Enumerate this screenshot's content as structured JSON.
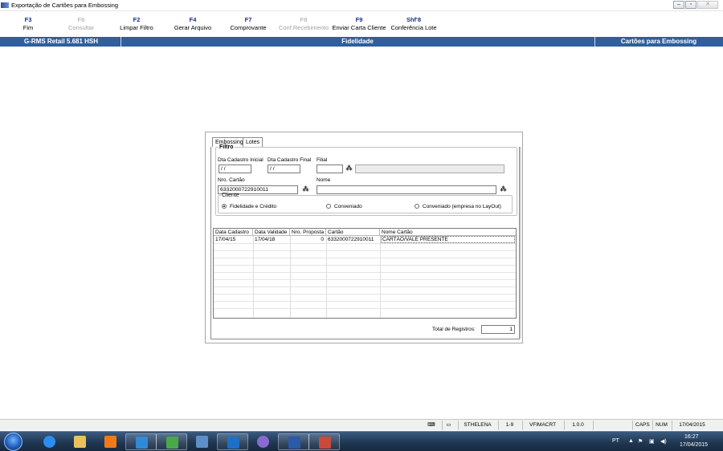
{
  "window": {
    "title": "Exportação de Cartões para Embossing",
    "controls": [
      "minimize-icon",
      "restore-icon",
      "close-icon"
    ]
  },
  "toolbar": [
    {
      "key": "F3",
      "label": "Fim",
      "enabled": true
    },
    {
      "key": "F6",
      "label": "Consultar",
      "enabled": false
    },
    {
      "key": "F2",
      "label": "Limpar Filtro",
      "enabled": true
    },
    {
      "key": "F4",
      "label": "Gerar Arquivo",
      "enabled": true
    },
    {
      "key": "F7",
      "label": "Comprovante",
      "enabled": true
    },
    {
      "key": "F8",
      "label": "Conf.Recebimento",
      "enabled": false
    },
    {
      "key": "F9",
      "label": "Enviar Carta Cliente",
      "enabled": true
    },
    {
      "key": "Shf'8",
      "label": "Conferência Lote",
      "enabled": true
    }
  ],
  "header_bar": {
    "system": "G-RMS Retail 5.681 HSH",
    "module": "Fidelidade",
    "screen": "Cartões para Embossing"
  },
  "dialog": {
    "tabs": [
      "Embossing",
      "Lotes"
    ],
    "active_tab": "Embossing",
    "filter": {
      "legend": "Filtro",
      "dta_cadastro_inicial": {
        "label": "Dta Cadastro Inicial",
        "value": " / /"
      },
      "dta_cadastro_final": {
        "label": "Dta Cadastro Final",
        "value": " / /"
      },
      "filial": {
        "label": "Filial",
        "value": "",
        "description": ""
      },
      "nro_cartao": {
        "label": "Nro. Cartão",
        "value": "6332000722910011"
      },
      "nome": {
        "label": "Nome",
        "value": ""
      },
      "cliente": {
        "legend": "Cliente",
        "options": [
          "Fidelidade e Crédito",
          "Conveniado",
          "Conveniado (empresa no LayOut)"
        ],
        "selected": "Fidelidade e Crédito"
      }
    },
    "grid": {
      "columns": [
        "Data Cadastro",
        "Data Validade",
        "Nro. Proposta",
        "Cartão",
        "Nome Cartão"
      ],
      "rows": [
        [
          "17/04/15",
          "17/04/18",
          "0",
          "6332000722910011",
          "CARTÃO/VALE PRESENTE"
        ]
      ]
    },
    "total": {
      "label": "Total de Registros:",
      "value": "1"
    }
  },
  "status_bar": {
    "user": "STHELENA",
    "company": "1-9",
    "program": "VFIMACRT",
    "version": "1.0.0",
    "caps": "CAPS",
    "num": "NUM",
    "date": "17/04/2015"
  },
  "taskbar": {
    "apps": [
      "internet-explorer-icon",
      "file-explorer-icon",
      "media-player-icon",
      "lync-icon",
      "app-icon",
      "app-icon",
      "outlook-icon",
      "app-icon",
      "word-icon",
      "app-icon"
    ],
    "language": "PT",
    "clock_time": "16:27",
    "clock_date": "17/04/2015"
  }
}
